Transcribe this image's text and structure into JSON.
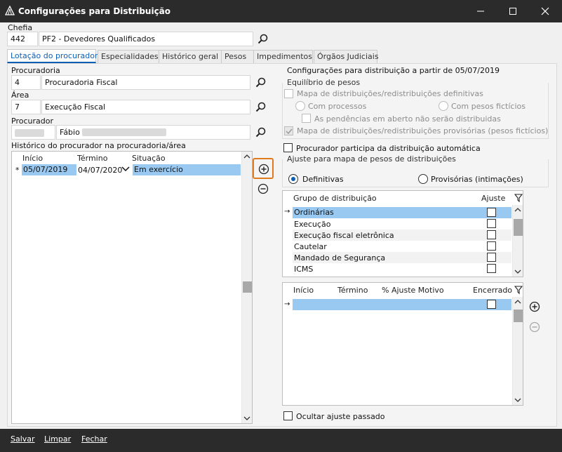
{
  "window": {
    "title": "Configurações para Distribuição"
  },
  "chefia": {
    "label": "Chefia",
    "code": "442",
    "name": "PF2 - Devedores Qualificados"
  },
  "tabs": [
    {
      "label": "Lotação do procurador"
    },
    {
      "label": "Especialidades"
    },
    {
      "label": "Histórico geral"
    },
    {
      "label": "Pesos"
    },
    {
      "label": "Impedimentos"
    },
    {
      "label": "Órgãos Judiciais"
    }
  ],
  "left": {
    "procuradoria": {
      "label": "Procuradoria",
      "code": "4",
      "name": "Procuradoria Fiscal"
    },
    "area": {
      "label": "Área",
      "code": "7",
      "name": "Execução Fiscal"
    },
    "procurador": {
      "label": "Procurador",
      "name": "Fábio"
    },
    "history": {
      "title": "Histórico do procurador na procuradoria/área",
      "columns": [
        "Início",
        "Término",
        "Situação"
      ],
      "row": {
        "marker": "*",
        "inicio": "05/07/2019",
        "termino": "04/07/2020",
        "situacao": "Em exercício"
      }
    }
  },
  "right": {
    "config_label": "Configurações para distribuição a partir de 05/07/2019",
    "equilibrio": {
      "title": "Equilíbrio de pesos",
      "mapa_definitivas": "Mapa de distribuições/redistribuições definitivas",
      "com_processos": "Com processos",
      "com_pesos": "Com pesos fictícios",
      "pendencias": "As pendências em aberto não serão distribuidas",
      "mapa_provisorias": "Mapa de distribuições/redistribuições provisórias (pesos fictícios)"
    },
    "participa": "Procurador participa da distribuição automática",
    "ajuste": {
      "title": "Ajuste para mapa de pesos de distribuições",
      "definitivas": "Definitivas",
      "provisorias": "Provisórias (intimações)"
    },
    "grupos": {
      "columns": [
        "Grupo de distribuição",
        "Ajuste"
      ],
      "rows": [
        "Ordinárias",
        "Execução",
        "Execução fiscal eletrônica",
        "Cautelar",
        "Mandado de Segurança",
        "ICMS"
      ]
    },
    "ajustes_grid": {
      "columns": [
        "Início",
        "Término",
        "% Ajuste Motivo",
        "Encerrado"
      ]
    },
    "ocultar": "Ocultar ajuste passado"
  },
  "bottom": {
    "salvar": "Salvar",
    "limpar": "Limpar",
    "fechar": "Fechar"
  }
}
